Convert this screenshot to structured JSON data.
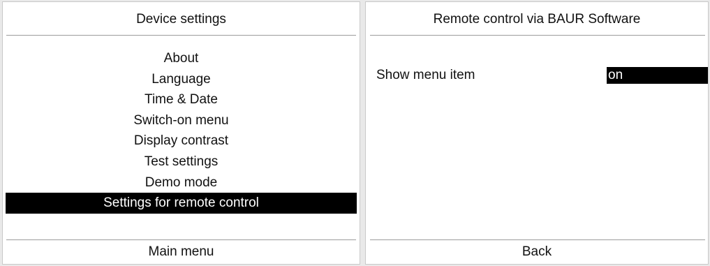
{
  "left_panel": {
    "title": "Device settings",
    "menu": [
      {
        "label": "About",
        "selected": false
      },
      {
        "label": "Language",
        "selected": false
      },
      {
        "label": "Time & Date",
        "selected": false
      },
      {
        "label": "Switch-on menu",
        "selected": false
      },
      {
        "label": "Display contrast",
        "selected": false
      },
      {
        "label": "Test settings",
        "selected": false
      },
      {
        "label": "Demo mode",
        "selected": false
      },
      {
        "label": "Settings for remote control",
        "selected": true
      }
    ],
    "footer": "Main menu"
  },
  "right_panel": {
    "title": "Remote control via BAUR Software",
    "setting": {
      "label": "Show menu item",
      "value": "on"
    },
    "footer": "Back"
  },
  "colors": {
    "selection_bg": "#000000",
    "selection_fg": "#ffffff",
    "divider": "#9c9c9c"
  }
}
